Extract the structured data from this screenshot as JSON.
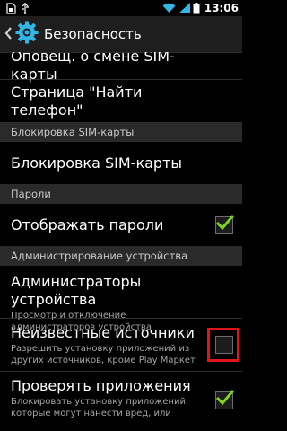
{
  "status_bar": {
    "time": "13:06",
    "icons": [
      "sim-icon",
      "usb-icon",
      "wifi-icon",
      "signal-icon",
      "battery-icon"
    ]
  },
  "action_bar": {
    "title": "Безопасность",
    "icons": [
      "back-arrow-icon",
      "settings-gear-icon"
    ]
  },
  "items": {
    "sim_change_alert": "Оповещ. о смене SIM-карты",
    "find_phone_page": "Страница \"Найти телефон\"",
    "sim_lock_header": "Блокировка SIM-карты",
    "sim_lock": "Блокировка SIM-карты",
    "passwords_header": "Пароли",
    "show_passwords": {
      "title": "Отображать пароли",
      "checked": true
    },
    "device_admin_header": "Администрирование устройства",
    "device_admins": {
      "title": "Администраторы устройства",
      "summary": "Просмотр и отключение администраторов устройства"
    },
    "unknown_sources": {
      "title": "Неизвестные источники",
      "summary": "Разрешить установку приложений из других источников, кроме Play Маркет",
      "checked": false
    },
    "verify_apps": {
      "title": "Проверять приложения",
      "summary": "Блокировать установку приложений, которые могут нанести вред, или",
      "checked": true
    }
  },
  "colors": {
    "checkmark": "#7ed321",
    "highlight": "#e1141a",
    "accent": "#33b5e5"
  }
}
